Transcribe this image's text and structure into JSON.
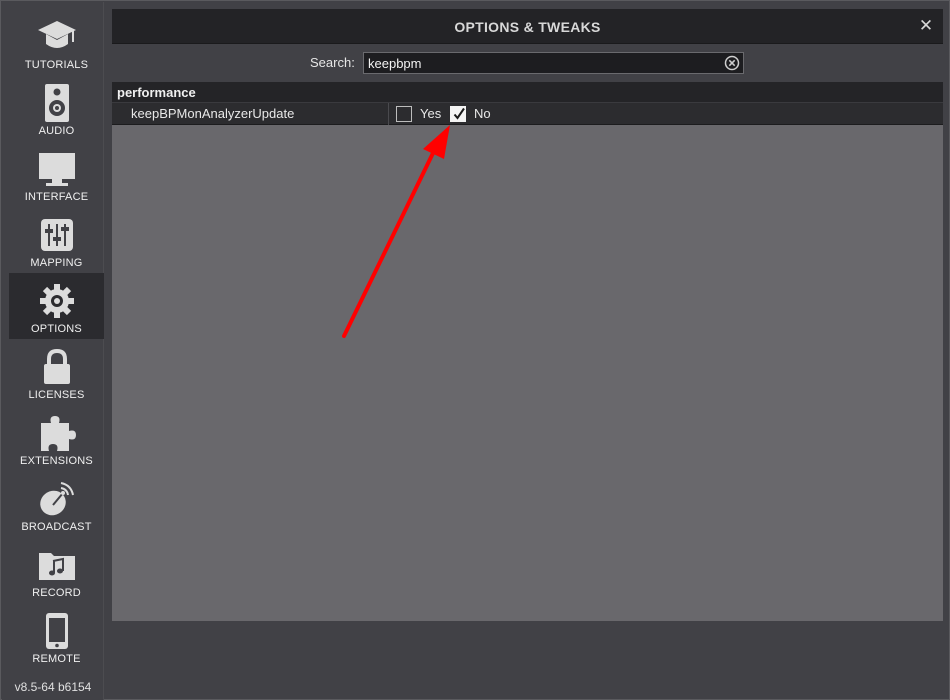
{
  "sidebar": {
    "items": [
      {
        "label": "TUTORIALS",
        "icon": "graduation-cap-icon"
      },
      {
        "label": "AUDIO",
        "icon": "speaker-icon"
      },
      {
        "label": "INTERFACE",
        "icon": "monitor-icon"
      },
      {
        "label": "MAPPING",
        "icon": "mixer-sliders-icon"
      },
      {
        "label": "OPTIONS",
        "icon": "gear-icon",
        "active": true
      },
      {
        "label": "LICENSES",
        "icon": "lock-icon"
      },
      {
        "label": "EXTENSIONS",
        "icon": "puzzle-icon"
      },
      {
        "label": "BROADCAST",
        "icon": "satellite-dish-icon"
      },
      {
        "label": "RECORD",
        "icon": "music-folder-icon"
      },
      {
        "label": "REMOTE",
        "icon": "phone-icon"
      }
    ],
    "version": "v8.5-64 b6154"
  },
  "window": {
    "title": "OPTIONS & TWEAKS",
    "close_glyph": "✕"
  },
  "search": {
    "label": "Search:",
    "value": "keepbpm"
  },
  "results": {
    "section": "performance",
    "rows": [
      {
        "name": "keepBPMonAnalyzerUpdate",
        "options": [
          {
            "label": "Yes",
            "checked": false
          },
          {
            "label": "No",
            "checked": true
          }
        ]
      }
    ]
  },
  "colors": {
    "accent_active": "#2b2b2f",
    "arrow": "#ff0000",
    "content_bg": "#69686c"
  }
}
